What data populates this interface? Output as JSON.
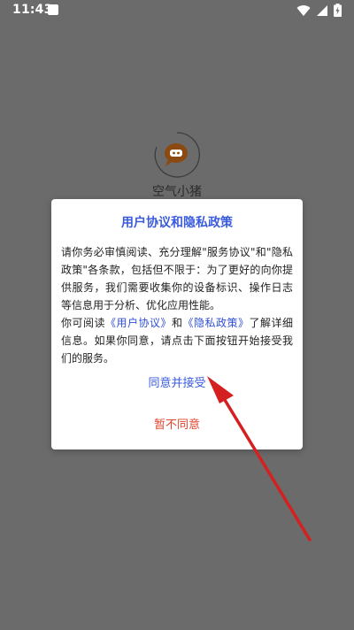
{
  "status_bar": {
    "time": "11:43"
  },
  "app": {
    "name": "空气小猪"
  },
  "dialog": {
    "title": "用户协议和隐私政策",
    "body_part1": "请你务必审慎阅读、充分理解\"服务协议\"和\"隐私政策\"各条款，包括但不限于：为了更好的向你提供服务，我们需要收集你的设备标识、操作日志等信息用于分析、优化应用性能。",
    "body_part2_prefix": "你可阅读",
    "user_agreement_link": "《用户协议》",
    "and_text": "和",
    "privacy_policy_link": "《隐私政策》",
    "body_part2_suffix": "了解详细信息。如果你同意，请点击下面按钮开始接受我们的服务。",
    "agree_button": "同意并接受",
    "disagree_button": "暂不同意"
  },
  "colors": {
    "background": "#6b6b6b",
    "title": "#3a5bdc",
    "link": "#2f4fd6",
    "disagree": "#e0442d",
    "annotation_arrow": "#d42020"
  },
  "icons": {
    "status_notif": "notification-square-icon",
    "wifi": "wifi-icon",
    "signal": "cellular-signal-icon",
    "battery": "battery-charging-icon",
    "logo": "pig-chat-bubble-logo"
  }
}
